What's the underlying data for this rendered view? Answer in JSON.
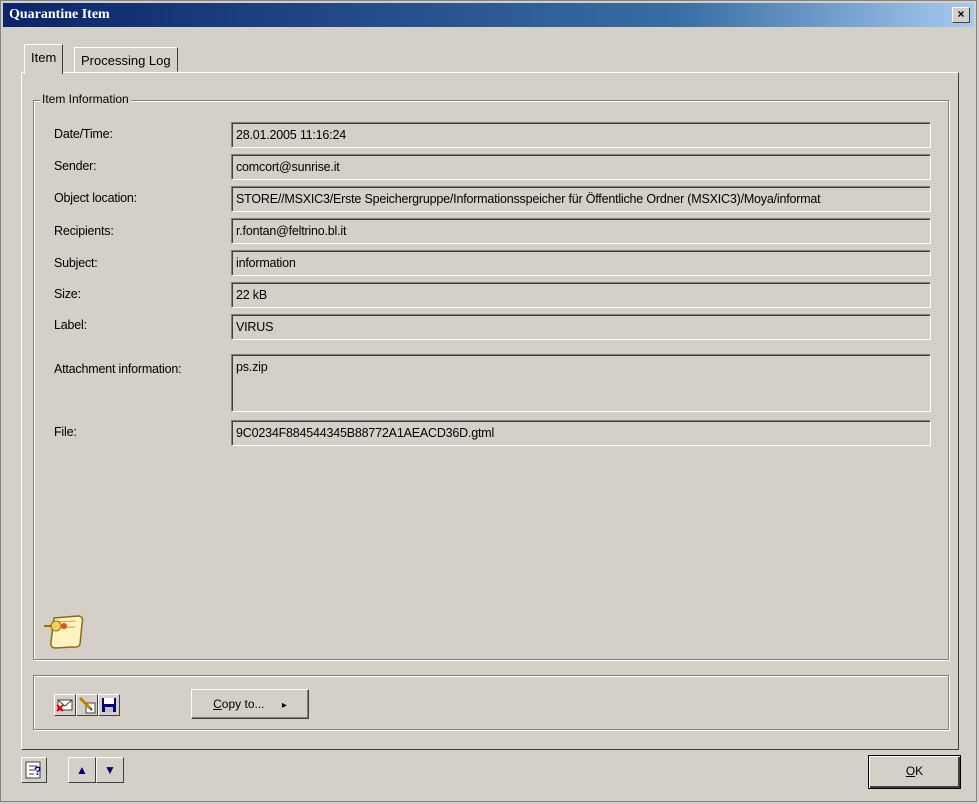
{
  "window": {
    "title": "Quarantine Item",
    "close_label": "×"
  },
  "tabs": [
    {
      "label": "Item"
    },
    {
      "label": "Processing Log"
    }
  ],
  "group": {
    "legend": "Item Information"
  },
  "fields": {
    "datetime": {
      "label": "Date/Time:",
      "value": "28.01.2005 11:16:24"
    },
    "sender": {
      "label": "Sender:",
      "value": "comcort@sunrise.it"
    },
    "object_location": {
      "label": "Object location:",
      "value": "STORE//MSXIC3/Erste Speichergruppe/Informationsspeicher für Öffentliche Ordner (MSXIC3)/Moya/informat"
    },
    "recipients": {
      "label": "Recipients:",
      "value": "r.fontan@feltrino.bl.it"
    },
    "subject": {
      "label": "Subject:",
      "value": "information"
    },
    "size": {
      "label": "Size:",
      "value": "22 kB"
    },
    "label": {
      "label": "Label:",
      "value": "VIRUS"
    },
    "attachment": {
      "label": "Attachment information:",
      "value": "ps.zip"
    },
    "file": {
      "label": "File:",
      "value": "9C0234F884544345B88772A1AEACD36D.gtml"
    }
  },
  "toolbar": {
    "copy_to_prefix": "C",
    "copy_to_rest": "opy to...",
    "copy_arrow": "▸"
  },
  "footer": {
    "up_label": "▲",
    "down_label": "▼",
    "ok_prefix": "O",
    "ok_rest": "K"
  },
  "icons": {
    "note": "note-pin-icon",
    "delete_mail": "delete-mail-icon",
    "edit": "pencil-icon",
    "save": "floppy-icon",
    "properties": "properties-icon"
  }
}
